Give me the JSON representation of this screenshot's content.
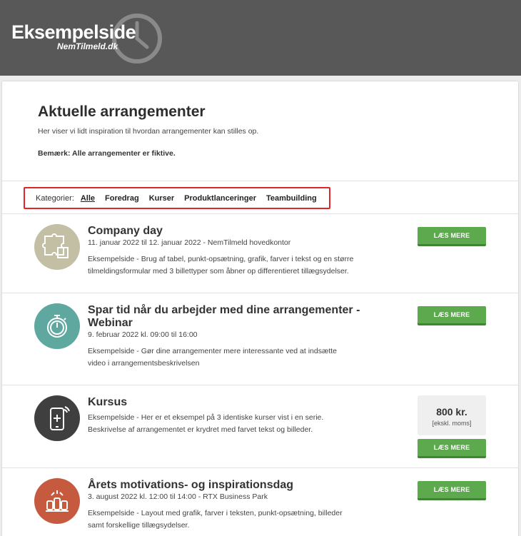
{
  "header": {
    "logo_title": "Eksempelside",
    "logo_subtitle": "NemTilmeld.dk"
  },
  "page": {
    "title": "Aktuelle arrangementer",
    "intro": "Her viser vi lidt inspiration til hvordan arrangementer kan stilles op.",
    "note": "Bemærk: Alle arrangementer er fiktive."
  },
  "categories": {
    "label": "Kategorier:",
    "items": [
      "Alle",
      "Foredrag",
      "Kurser",
      "Produktlanceringer",
      "Teambuilding"
    ],
    "active": "Alle"
  },
  "events": [
    {
      "title": "Company day",
      "date": "11. januar 2022 til 12. januar 2022 - NemTilmeld hovedkontor",
      "desc_line1": "Eksempelside - Brug af tabel, punkt-opsætning, grafik, farver i tekst og en større",
      "desc_line2": "tilmeldingsformular med 3 billettyper som åbner op differentieret tillægsydelser.",
      "button": "LÆS MERE",
      "icon": "puzzle-icon",
      "icon_color": "#c2bfa5"
    },
    {
      "title_line1": "Spar tid når du arbejder med dine arrangementer -",
      "title_line2": "Webinar",
      "date": "9. februar 2022 kl. 09:00 til 16:00",
      "desc_line1": "Eksempelside - Gør dine arrangementer mere interessante ved at indsætte",
      "desc_line2": "video i arrangementsbeskrivelsen",
      "button": "LÆS MERE",
      "icon": "stopwatch-icon",
      "icon_color": "#5fa8a0"
    },
    {
      "title": "Kursus",
      "desc_line1": "Eksempelside - Her er et eksempel på 3 identiske kurser vist i en serie.",
      "desc_line2": "Beskrivelse af arrangementet er krydret med farvet tekst og billeder.",
      "price": "800 kr.",
      "price_note": "[ekskl. moms]",
      "button": "LÆS MERE",
      "icon": "mobile-phone-icon",
      "icon_color": "#3f3f3f"
    },
    {
      "title": "Årets motivations- og inspirationsdag",
      "date": "3. august 2022 kl. 12:00 til 14:00 - RTX Business Park",
      "desc_line1": "Eksempelside - Layout med grafik, farver i teksten, punkt-opsætning, billeder",
      "desc_line2": "samt forskellige tillægsydelser.",
      "button": "LÆS MERE",
      "icon": "raised-fists-icon",
      "icon_color": "#c65a3e"
    }
  ],
  "colors": {
    "header_bg": "#585858",
    "button_green": "#5daa4e",
    "category_outline": "#e0262b"
  }
}
